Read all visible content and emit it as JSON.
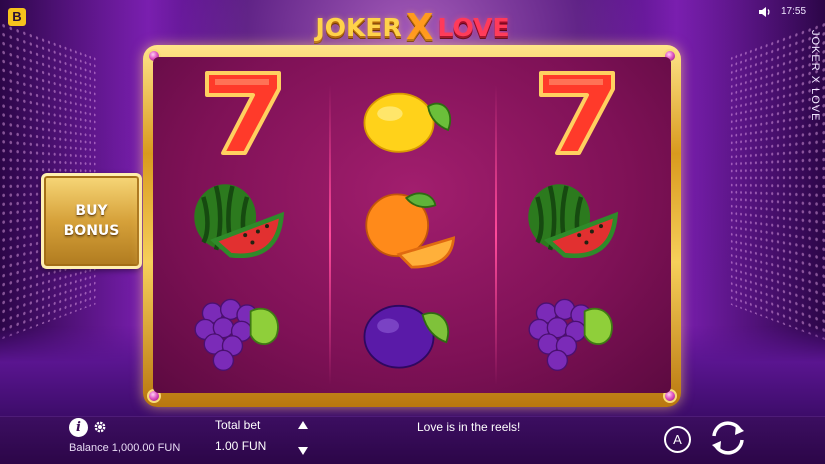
{
  "brand": {
    "logo_letter": "B"
  },
  "status": {
    "time": "17:55",
    "sound_icon": "speaker-icon"
  },
  "game": {
    "title_vertical": "JOKER X LOVE",
    "logo": {
      "word1": "JOKER",
      "word2": "X",
      "word3": "LOVE"
    }
  },
  "reels": [
    {
      "symbols": [
        "seven",
        "watermelon",
        "grapes"
      ]
    },
    {
      "symbols": [
        "lemon",
        "orange",
        "plum"
      ]
    },
    {
      "symbols": [
        "seven",
        "watermelon",
        "grapes"
      ]
    }
  ],
  "buy_bonus": {
    "line1": "BUY",
    "line2": "BONUS"
  },
  "bottom": {
    "info_icon": "i",
    "balance": "Balance 1,000.00 FUN",
    "bet_label": "Total bet",
    "bet_value": "1.00 FUN",
    "message": "Love is in the reels!",
    "autoplay_label": "A"
  },
  "colors": {
    "accent_gold": "#f6cf5a",
    "reel_bg": "#7e1156",
    "brand": "#f6c21c"
  }
}
